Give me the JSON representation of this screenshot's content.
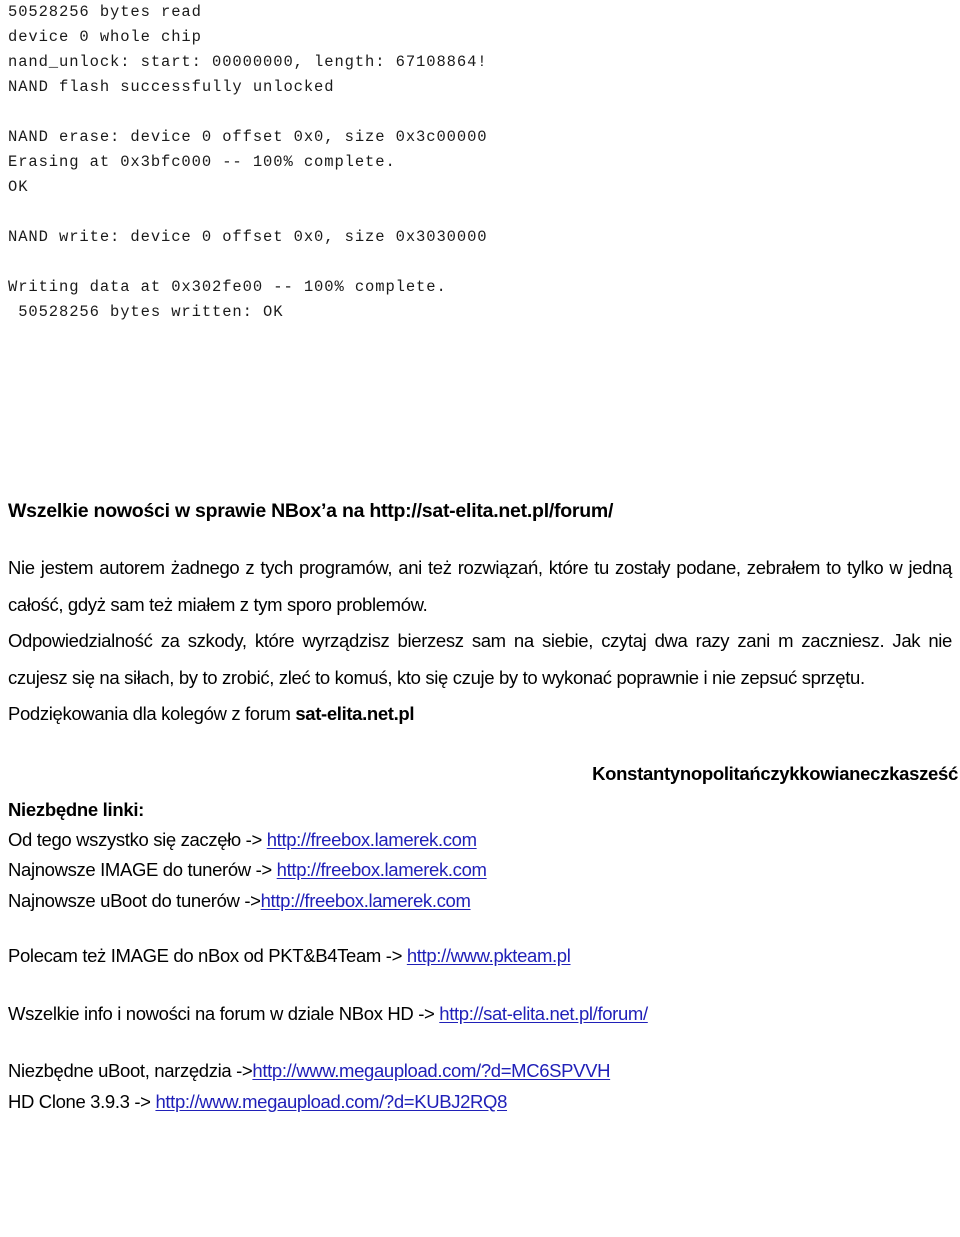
{
  "console": {
    "lines": [
      "50528256 bytes read",
      "device 0 whole chip",
      "nand_unlock: start: 00000000, length: 67108864!",
      "NAND flash successfully unlocked",
      "",
      "NAND erase: device 0 offset 0x0, size 0x3c00000",
      "Erasing at 0x3bfc000 -- 100% complete.",
      "OK",
      "",
      "NAND write: device 0 offset 0x0, size 0x3030000",
      "",
      "Writing data at 0x302fe00 -- 100% complete.",
      " 50528256 bytes written: OK"
    ]
  },
  "document": {
    "heading": "Wszelkie nowości w sprawie NBox’a na http://sat-elita.net.pl/forum/",
    "paragraph_1": "Nie jestem autorem żadnego z tych programów, ani też rozwiązań, które tu zostały podane, zebrałem to tylko w jedną całość, gdyż sam też miałem z tym sporo problemów.",
    "paragraph_2": "Odpowiedzialność za szkody, które wyrządzisz bierzesz sam na siebie, czytaj dwa razy zani m zaczniesz. Jak nie czujesz się na siłach, by to zrobić, zleć to komuś, kto się czuje by to wykonać poprawnie i nie zepsuć sprzętu.",
    "thanks_prefix": "Podziękowania dla kolegów z forum ",
    "thanks_bold": "sat-elita.net.pl",
    "konstantynopol": "Konstantynopolitańczykkowianeczkasześć",
    "links_heading": "Niezbędne linki:"
  },
  "links": {
    "row1": {
      "text": "Od tego wszystko się zaczęło -> ",
      "url": "http://freebox.lamerek.com"
    },
    "row2": {
      "text": "Najnowsze IMAGE do tunerów -> ",
      "url": "http://freebox.lamerek.com"
    },
    "row3": {
      "text": "Najnowsze uBoot do tunerów ->",
      "url": "http://freebox.lamerek.com"
    },
    "row4": {
      "text": "Polecam też IMAGE do nBox od PKT&B4Team -> ",
      "url": "http://www.pkteam.pl"
    },
    "row5": {
      "text": "Wszelkie info i nowości na forum w dziale NBox HD -> ",
      "url": "http://sat-elita.net.pl/forum/"
    },
    "row6": {
      "text": "Niezbędne uBoot, narzędzia ->",
      "url": "http://www.megaupload.com/?d=MC6SPVVH"
    },
    "row7": {
      "text": "HD Clone 3.9.3 -> ",
      "url": "http://www.megaupload.com/?d=KUBJ2RQ8"
    }
  },
  "colors": {
    "link": "#2020b8",
    "text": "#000000",
    "console_text": "#1a1a1a",
    "background": "#ffffff"
  }
}
